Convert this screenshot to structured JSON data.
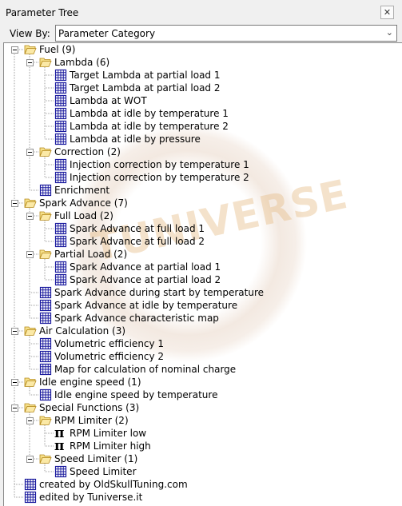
{
  "window": {
    "title": "Parameter Tree",
    "close_glyph": "✕"
  },
  "view_by": {
    "label": "View By:",
    "value": "Parameter Category",
    "chevron": "⌄"
  },
  "watermark": {
    "text": "TUNIVERSE"
  },
  "tree": [
    {
      "label": "Fuel (9)",
      "level": 0,
      "type": "folder",
      "expander": true
    },
    {
      "label": "Lambda (6)",
      "level": 1,
      "type": "folder",
      "expander": true
    },
    {
      "label": "Target Lambda at partial load 1",
      "level": 2,
      "type": "table"
    },
    {
      "label": "Target Lambda at partial load 2",
      "level": 2,
      "type": "table"
    },
    {
      "label": "Lambda at WOT",
      "level": 2,
      "type": "table"
    },
    {
      "label": "Lambda at idle by temperature 1",
      "level": 2,
      "type": "table"
    },
    {
      "label": "Lambda at idle by temperature 2",
      "level": 2,
      "type": "table"
    },
    {
      "label": "Lambda at idle by pressure",
      "level": 2,
      "type": "table"
    },
    {
      "label": "Correction (2)",
      "level": 1,
      "type": "folder",
      "expander": true
    },
    {
      "label": "Injection correction by temperature 1",
      "level": 2,
      "type": "table"
    },
    {
      "label": "Injection correction by temperature 2",
      "level": 2,
      "type": "table"
    },
    {
      "label": "Enrichment",
      "level": 1,
      "type": "table"
    },
    {
      "label": "Spark Advance (7)",
      "level": 0,
      "type": "folder",
      "expander": true
    },
    {
      "label": "Full Load (2)",
      "level": 1,
      "type": "folder",
      "expander": true
    },
    {
      "label": "Spark Advance at full load 1",
      "level": 2,
      "type": "table"
    },
    {
      "label": "Spark Advance at full load 2",
      "level": 2,
      "type": "table"
    },
    {
      "label": "Partial Load (2)",
      "level": 1,
      "type": "folder",
      "expander": true
    },
    {
      "label": "Spark Advance at partial load 1",
      "level": 2,
      "type": "table"
    },
    {
      "label": "Spark Advance at partial load 2",
      "level": 2,
      "type": "table"
    },
    {
      "label": "Spark Advance during start by temperature",
      "level": 1,
      "type": "table"
    },
    {
      "label": "Spark Advance at idle by temperature",
      "level": 1,
      "type": "table"
    },
    {
      "label": "Spark Advance characteristic map",
      "level": 1,
      "type": "table"
    },
    {
      "label": "Air Calculation (3)",
      "level": 0,
      "type": "folder",
      "expander": true
    },
    {
      "label": "Volumetric efficiency 1",
      "level": 1,
      "type": "table"
    },
    {
      "label": "Volumetric efficiency 2",
      "level": 1,
      "type": "table"
    },
    {
      "label": "Map for calculation of nominal charge",
      "level": 1,
      "type": "table"
    },
    {
      "label": "Idle engine speed (1)",
      "level": 0,
      "type": "folder",
      "expander": true
    },
    {
      "label": "Idle engine speed by temperature",
      "level": 1,
      "type": "table"
    },
    {
      "label": "Special Functions (3)",
      "level": 0,
      "type": "folder",
      "expander": true
    },
    {
      "label": "RPM Limiter (2)",
      "level": 1,
      "type": "folder",
      "expander": true
    },
    {
      "label": "RPM Limiter low",
      "level": 2,
      "type": "pi"
    },
    {
      "label": "RPM Limiter high",
      "level": 2,
      "type": "pi"
    },
    {
      "label": "Speed Limiter (1)",
      "level": 1,
      "type": "folder",
      "expander": true
    },
    {
      "label": "Speed Limiter",
      "level": 2,
      "type": "table"
    },
    {
      "label": "created by OldSkullTuning.com",
      "level": 0,
      "type": "table"
    },
    {
      "label": "edited by Tuniverse.it",
      "level": 0,
      "type": "table"
    }
  ],
  "icons": {
    "folder": "open-folder-icon",
    "table": "table-grid-icon",
    "pi": "pi-constant-icon"
  },
  "pi_glyph": "π",
  "colors": {
    "table_icon": "#1a1a9e",
    "folder_fill": "#f6e08a",
    "folder_edge": "#b58a1e",
    "tree_line": "#a0a0a0"
  }
}
